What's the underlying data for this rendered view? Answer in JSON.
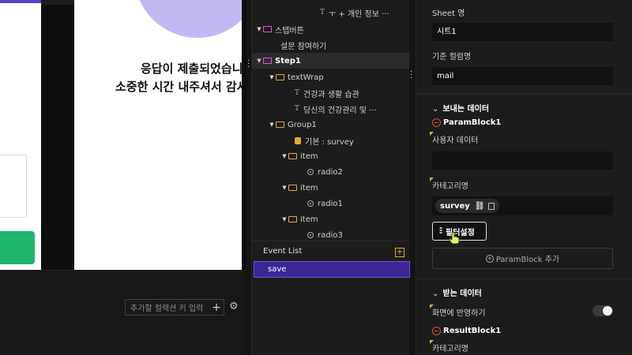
{
  "canvas": {
    "preview_line1": "응답이 제출되었습니",
    "preview_line2": "소중한 시간 내주셔서 감사",
    "collection_placeholder": "추가할 컬렉션 키 입력",
    "collection_add": "+",
    "colors": {
      "accent": "#5b3fd1",
      "green": "#1fb56b",
      "circle": "#c3b8f3"
    }
  },
  "tree": {
    "items": [
      {
        "label": "ㅜ + 개인 정보 ···",
        "icon": "text-icon"
      },
      {
        "label": "스텝버튼",
        "icon": "step-folder-icon"
      },
      {
        "label": "설문 참여하기",
        "icon": "none"
      },
      {
        "label": "Step1",
        "icon": "step-folder-icon"
      },
      {
        "label": "textWrap",
        "icon": "folder-icon"
      },
      {
        "label": "건강과 생활 습관",
        "icon": "text-icon"
      },
      {
        "label": "당신의 건강관리 및 ···",
        "icon": "text-icon"
      },
      {
        "label": "Group1",
        "icon": "folder-icon"
      },
      {
        "label": "기본 : survey",
        "icon": "data-icon"
      },
      {
        "label": "item",
        "icon": "folder-icon"
      },
      {
        "label": "radio2",
        "icon": "radio-icon"
      },
      {
        "label": "item",
        "icon": "folder-icon"
      },
      {
        "label": "radio1",
        "icon": "radio-icon"
      },
      {
        "label": "item",
        "icon": "folder-icon"
      },
      {
        "label": "radio3",
        "icon": "radio-icon"
      }
    ]
  },
  "events": {
    "title": "Event List",
    "add": "+",
    "items": [
      "save"
    ]
  },
  "props": {
    "sheet_label": "Sheet 명",
    "sheet_value": "시트1",
    "column_label": "기준 컬럼명",
    "column_value": "mail",
    "send_section": "보내는 데이터",
    "param_block": "ParamBlock1",
    "user_data_label": "사용자 데이터",
    "category_label": "카테고리명",
    "chip": "survey",
    "filter_btn": "필터설정",
    "add_param_block": "ParamBlock 추가",
    "receive_section": "받는 데이터",
    "reflect_label": "화면에 반영하기",
    "reflect_on": false,
    "result_block": "ResultBlock1",
    "category_label2": "카테고리명"
  }
}
